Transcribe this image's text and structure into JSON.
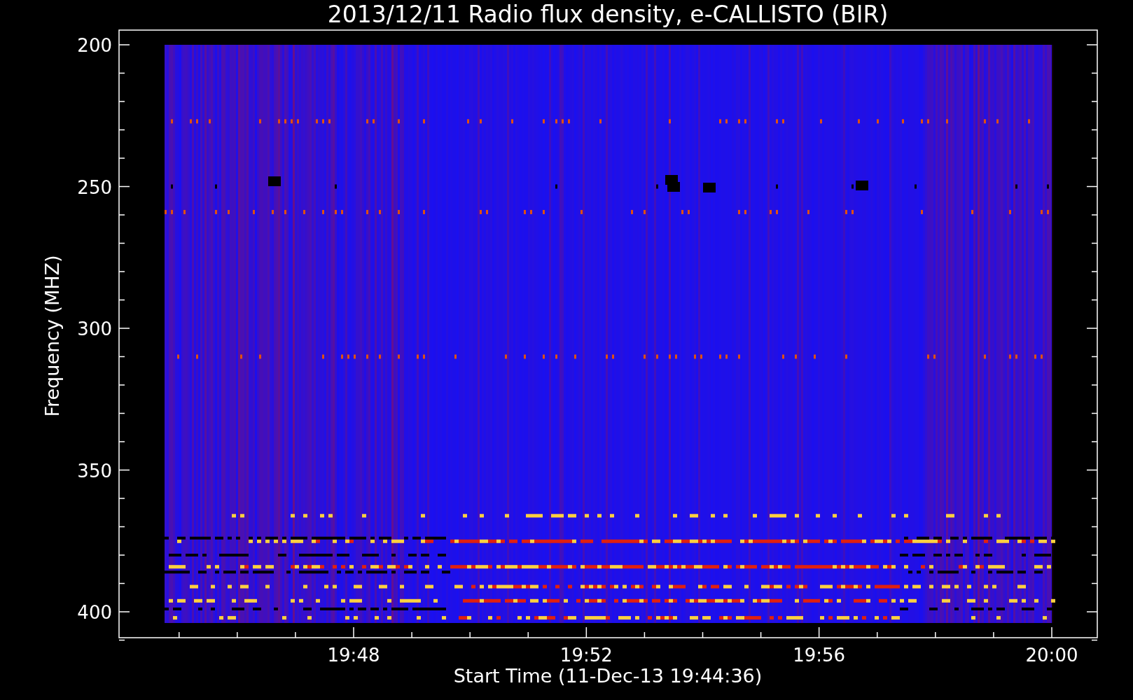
{
  "title": "2013/12/11  Radio flux density, e-CALLISTO (BIR)",
  "y_axis": {
    "label": "Frequency (MHZ)",
    "ticks": [
      "200",
      "250",
      "300",
      "350",
      "400"
    ]
  },
  "x_axis": {
    "label": "Start Time (11-Dec-13 19:44:36)",
    "ticks": [
      "19:48",
      "19:52",
      "19:56",
      "20:00"
    ]
  }
}
